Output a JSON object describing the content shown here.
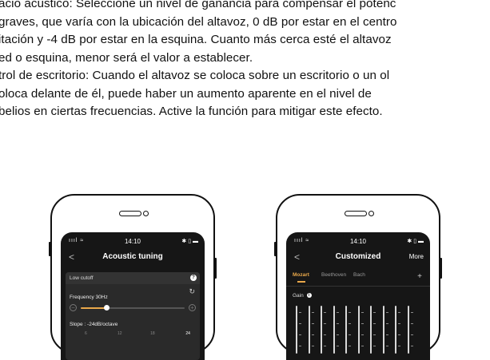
{
  "paragraph": {
    "lines": [
      "acio acústico: Seleccione un nivel de ganancia para compensar el potenc",
      "graves, que varía con la ubicación del altavoz, 0 dB por estar en el centro",
      "itación y -4 dB por estar en la esquina. Cuanto más cerca esté el altavoz",
      "ed o esquina, menor será el valor a establecer.",
      "trol de escritorio: Cuando el altavoz se coloca sobre un escritorio o un ol",
      "oloca delante de él, puede haber un aumento aparente en el nivel de",
      "belios en ciertas frecuencias. Active la función para mitigar este efecto."
    ]
  },
  "phone_left": {
    "status": {
      "time": "14:10",
      "signal": "ıııl ≈",
      "icons": "✱ ▯ ▬"
    },
    "nav": {
      "back": "<",
      "title": "Acoustic tuning"
    },
    "card": {
      "header": "Low cutoff",
      "help_icon": "?",
      "frequency_label": "Frequency  30Hz",
      "reset_icon": "↻",
      "minus_icon": "−",
      "plus_icon": "+",
      "slope_label": "Slope : -24dB/octave",
      "slope_ticks": [
        "6",
        "12",
        "18",
        "24"
      ]
    },
    "slider": {
      "value_fraction": 0.25
    },
    "accent_color": "#e9a84a"
  },
  "phone_right": {
    "status": {
      "time": "14:10",
      "signal": "ıııl ≈",
      "icons": "✱ ▯ ▬"
    },
    "nav": {
      "back": "<",
      "title": "Customized",
      "more": "More"
    },
    "tabs": [
      {
        "label": "Mozart",
        "active": true
      },
      {
        "label": "Beethoven",
        "active": false
      },
      {
        "label": "Bach",
        "active": false
      }
    ],
    "add_icon": "+",
    "gain_label": "Gain",
    "gain_info_icon": "i",
    "eq_band_count": 10
  }
}
